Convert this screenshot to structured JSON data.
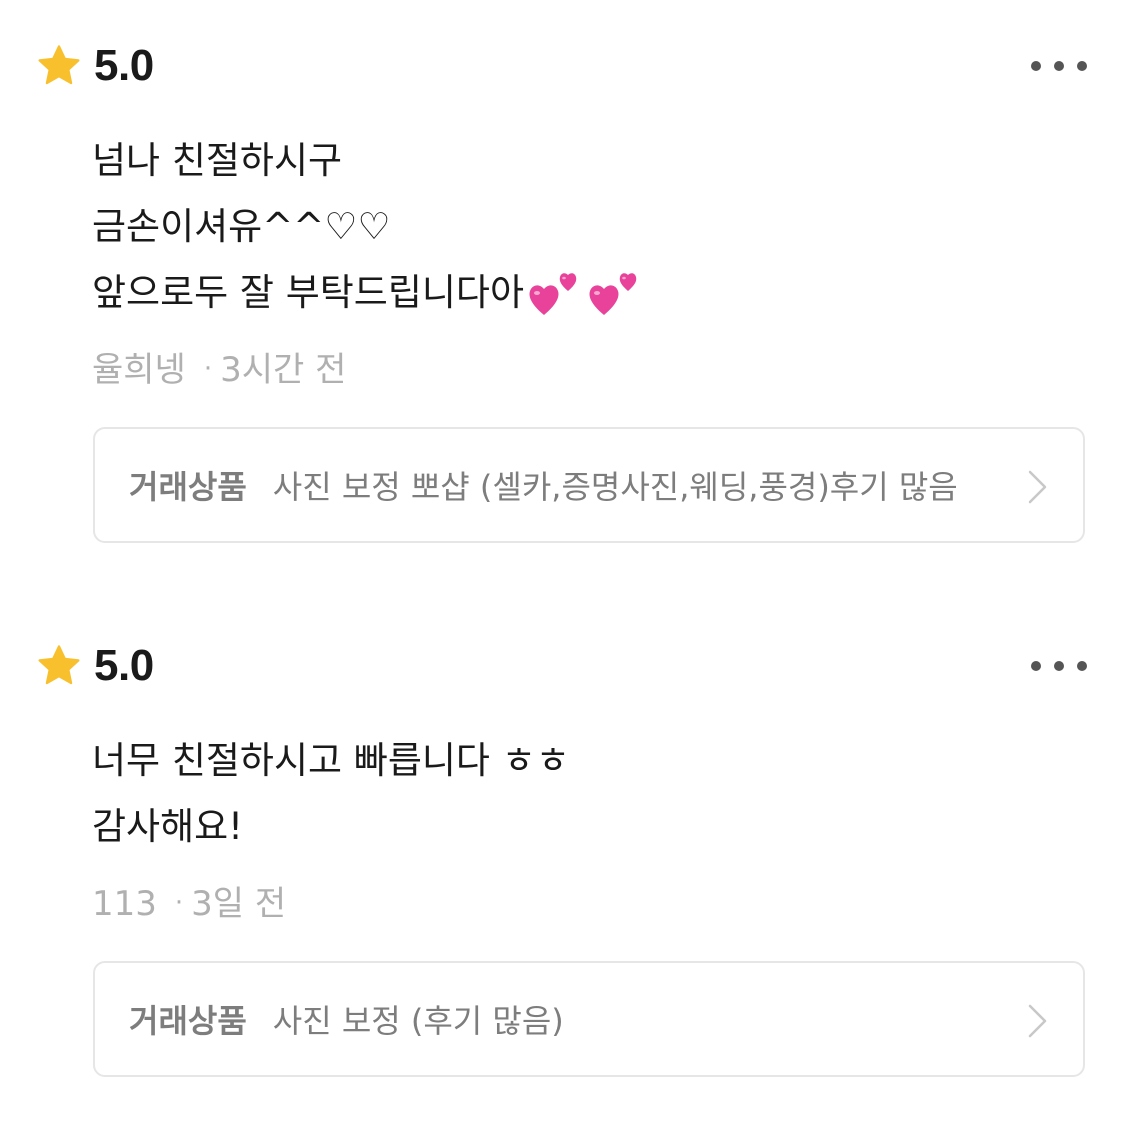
{
  "reviews": [
    {
      "rating": "5.0",
      "lines": [
        "넘나 친절하시구",
        "금손이셔유^^♡♡",
        "앞으로두 잘 부탁드립니다아"
      ],
      "emojis": [
        "two-hearts",
        "two-hearts"
      ],
      "author": "율희넹",
      "separator": "·",
      "time": "3시간 전",
      "product_label": "거래상품",
      "product_name": "사진 보정 뽀샵 (셀카,증명사진,웨딩,풍경)후기 많음"
    },
    {
      "rating": "5.0",
      "lines": [
        "너무 친절하시고 빠릅니다 ㅎㅎ",
        "감사해요!"
      ],
      "author": "113",
      "separator": "·",
      "time": "3일 전",
      "product_label": "거래상품",
      "product_name": "사진 보정 (후기 많음)"
    }
  ],
  "icons": {
    "star": "star-icon",
    "more": "more-horizontal-icon",
    "chevron": "chevron-right-icon",
    "emoji": "two-hearts-emoji-icon"
  },
  "colors": {
    "star": "#F9C02E",
    "text": "#1a1a1a",
    "meta": "#b0b0b0",
    "product_text": "#7d7d7d",
    "border": "#e6e6e6",
    "heart": "#E8429A"
  }
}
